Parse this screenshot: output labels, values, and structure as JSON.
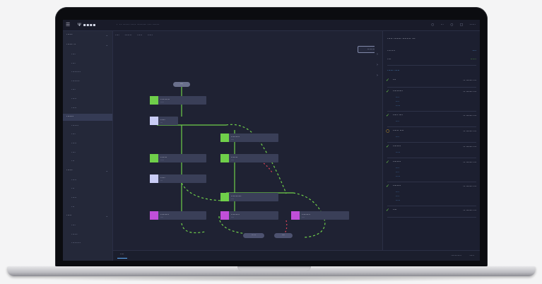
{
  "app": {
    "menu_icon": "hamburger-icon",
    "logo": "Ψ ▪▪▪▪",
    "breadcrumb": "· ·· ····· ···· ······· ··· ·····",
    "top_right": [
      "○",
      "···",
      "○",
      "□",
      "······"
    ]
  },
  "sidebar": {
    "items": [
      {
        "label": "······",
        "type": "sec"
      },
      {
        "label": "······ ··",
        "type": "sec"
      },
      {
        "label": "····",
        "type": "item"
      },
      {
        "label": "····",
        "type": "item"
      },
      {
        "label": "·········",
        "type": "item"
      },
      {
        "label": "········",
        "type": "item"
      },
      {
        "label": "····",
        "type": "item"
      },
      {
        "label": "·····",
        "type": "item"
      },
      {
        "label": "·····",
        "type": "item"
      },
      {
        "label": "·······",
        "type": "active"
      },
      {
        "label": "·······",
        "type": "item"
      },
      {
        "label": "····",
        "type": "item"
      },
      {
        "label": "·····",
        "type": "item"
      },
      {
        "label": "····",
        "type": "item"
      },
      {
        "label": "···",
        "type": "item"
      },
      {
        "label": "······",
        "type": "sec"
      },
      {
        "label": "·····",
        "type": "item"
      },
      {
        "label": "···",
        "type": "item"
      },
      {
        "label": "·····",
        "type": "item"
      },
      {
        "label": "···",
        "type": "item"
      },
      {
        "label": "·····",
        "type": "sec"
      },
      {
        "label": "····",
        "type": "item"
      },
      {
        "label": "······",
        "type": "item"
      },
      {
        "label": "·········",
        "type": "item"
      }
    ]
  },
  "main": {
    "tabs": [
      "····",
      "·······",
      "·····",
      "·····"
    ],
    "action_button": "········",
    "start_pill": "····",
    "nodes": [
      {
        "label": "··········",
        "sub": "·····",
        "color": "#6fcf4a"
      },
      {
        "label": "·····",
        "sub": "···",
        "color": "#c9ccf5"
      },
      {
        "label": "·······",
        "sub": "·····",
        "color": "#6fcf4a"
      },
      {
        "label": "·········",
        "sub": "····",
        "color": "#6fcf4a"
      },
      {
        "label": "·······",
        "sub": "····",
        "color": "#6fcf4a"
      },
      {
        "label": "·····",
        "sub": "···",
        "color": "#c9ccf5"
      },
      {
        "label": "···········",
        "sub": "····",
        "color": "#6fcf4a"
      },
      {
        "label": "·········",
        "sub": "····",
        "color": "#c04fd9"
      },
      {
        "label": "·········",
        "sub": "····",
        "color": "#c04fd9"
      },
      {
        "label": "·········",
        "sub": "····",
        "color": "#c04fd9"
      }
    ],
    "end_pills": [
      "·····",
      "····"
    ]
  },
  "panel": {
    "title": "····· ······· ········ ···",
    "rows": [
      {
        "label": "········",
        "value": "····"
      },
      {
        "label": "····",
        "value": "······"
      }
    ],
    "section_title": "······ ·····",
    "steps": [
      {
        "icon": "check-circle-icon",
        "color": "#6fcf4a",
        "name": "···",
        "time": "·· ······· ···",
        "links": []
      },
      {
        "icon": "check-circle-icon",
        "color": "#6fcf4a",
        "name": "··········",
        "time": "·· ······· ···",
        "links": [
          "····",
          "····",
          "·····"
        ]
      },
      {
        "icon": "check-circle-icon",
        "color": "#6fcf4a",
        "name": "····· ····",
        "time": "·· ······· ···",
        "links": [
          "····"
        ]
      },
      {
        "icon": "warning-circle-icon",
        "color": "#f0b429",
        "name": "······ ····",
        "time": "·· ······· ···",
        "links": [
          "····"
        ]
      },
      {
        "icon": "check-circle-icon",
        "color": "#6fcf4a",
        "name": "········",
        "time": "·· ······· ···",
        "links": [
          "·····"
        ]
      },
      {
        "icon": "check-circle-icon",
        "color": "#6fcf4a",
        "name": "········",
        "time": "·· ······· ···",
        "links": [
          "····",
          "····",
          "·····"
        ]
      },
      {
        "icon": "check-circle-icon",
        "color": "#6fcf4a",
        "name": "········",
        "time": "·· ······· ···",
        "links": [
          "····",
          "····",
          "·····"
        ]
      },
      {
        "icon": "check-circle-icon",
        "color": "#6fcf4a",
        "name": "····",
        "time": "·· ······· ···",
        "links": []
      }
    ]
  },
  "bottombar": {
    "tab": "····",
    "right": [
      "···········",
      "·····"
    ]
  },
  "colors": {
    "accent": "#5fb0ff",
    "success": "#6fcf4a",
    "warning": "#f0b429",
    "error": "#e0445a",
    "edge_purple": "#c04fd9"
  }
}
